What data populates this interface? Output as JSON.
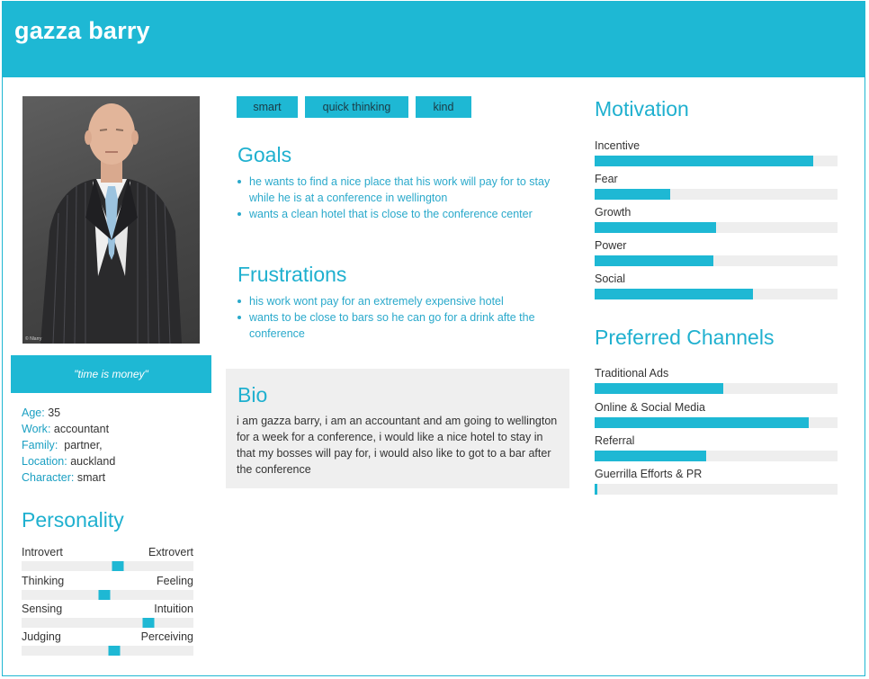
{
  "header": {
    "name": "gazza barry"
  },
  "photo": {
    "copyright": "© Nlarry"
  },
  "quote": "\"time is money\"",
  "info": [
    {
      "label": "Age",
      "value": "35",
      "sep": ": "
    },
    {
      "label": "Work",
      "value": "accountant",
      "sep": ": "
    },
    {
      "label": "Family",
      "value": "partner,",
      "sep": ":  "
    },
    {
      "label": "Location",
      "value": "auckland",
      "sep": ": "
    },
    {
      "label": "Character",
      "value": "smart",
      "sep": ": "
    }
  ],
  "personality": {
    "title": "Personality",
    "scales": [
      {
        "left": "Introvert",
        "right": "Extrovert",
        "position": 0.56
      },
      {
        "left": "Thinking",
        "right": "Feeling",
        "position": 0.48
      },
      {
        "left": "Sensing",
        "right": "Intuition",
        "position": 0.74
      },
      {
        "left": "Judging",
        "right": "Perceiving",
        "position": 0.54
      }
    ]
  },
  "tags": [
    "smart",
    "quick thinking",
    "kind"
  ],
  "goals": {
    "title": "Goals",
    "items": [
      "he wants to find a nice place that his work will pay for to stay while he is at a conference in wellington",
      "wants a clean hotel that is close to the conference center"
    ]
  },
  "frustrations": {
    "title": "Frustrations",
    "items": [
      "his work wont pay for an extremely expensive hotel",
      "wants to be close to bars so he can go for a drink afte the conference"
    ]
  },
  "bio": {
    "title": "Bio",
    "text": "i am gazza barry, i am an accountant and am going to wellington for a week for a conference, i would like a nice hotel to stay in that my bosses will pay for, i would also like to got to a bar after the conference"
  },
  "motivation": {
    "title": "Motivation",
    "items": [
      {
        "label": "Incentive",
        "level": 0.9
      },
      {
        "label": "Fear",
        "level": 0.31
      },
      {
        "label": "Growth",
        "level": 0.5
      },
      {
        "label": "Power",
        "level": 0.49
      },
      {
        "label": "Social",
        "level": 0.65
      }
    ]
  },
  "channels": {
    "title": "Preferred Channels",
    "items": [
      {
        "label": "Traditional Ads",
        "level": 0.53
      },
      {
        "label": "Online & Social Media",
        "level": 0.88
      },
      {
        "label": "Referral",
        "level": 0.46
      },
      {
        "label": "Guerrilla Efforts & PR",
        "level": 0.01
      }
    ]
  },
  "colors": {
    "accent": "#1eb8d4",
    "track": "#eeeeee",
    "bioBackground": "#efefef"
  }
}
